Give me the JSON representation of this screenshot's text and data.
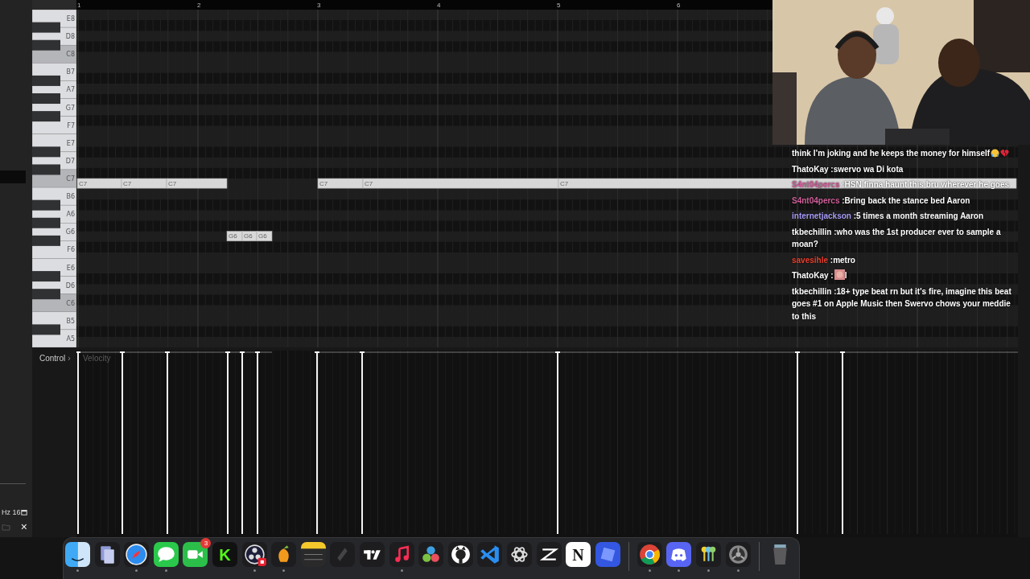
{
  "ruler": {
    "bars": [
      "1",
      "2",
      "3",
      "4",
      "5",
      "6"
    ]
  },
  "piano": {
    "keys": [
      {
        "label": "E8",
        "highlighted": false
      },
      {
        "label": "D8",
        "highlighted": false
      },
      {
        "label": "C8",
        "highlighted": true
      },
      {
        "label": "B7",
        "highlighted": false
      },
      {
        "label": "A7",
        "highlighted": false
      },
      {
        "label": "G7",
        "highlighted": false
      },
      {
        "label": "F7",
        "highlighted": false
      },
      {
        "label": "E7",
        "highlighted": false
      },
      {
        "label": "D7",
        "highlighted": false
      },
      {
        "label": "C7",
        "highlighted": true
      },
      {
        "label": "B6",
        "highlighted": false
      },
      {
        "label": "A6",
        "highlighted": false
      },
      {
        "label": "G6",
        "highlighted": false
      },
      {
        "label": "F6",
        "highlighted": false
      },
      {
        "label": "E6",
        "highlighted": false
      },
      {
        "label": "D6",
        "highlighted": false
      },
      {
        "label": "C6",
        "highlighted": true
      },
      {
        "label": "B5",
        "highlighted": false
      },
      {
        "label": "A5",
        "highlighted": false
      }
    ]
  },
  "notes": [
    {
      "label": "C7"
    },
    {
      "label": "C7"
    },
    {
      "label": "C7"
    },
    {
      "label": "G6"
    },
    {
      "label": "G6"
    },
    {
      "label": "G6"
    },
    {
      "label": "C7"
    },
    {
      "label": "C7"
    },
    {
      "label": "C7"
    }
  ],
  "control": {
    "label": "Control",
    "arrow": "›",
    "parameter": "Velocity"
  },
  "sidebar": {
    "readout": "Hz 16",
    "close": "×"
  },
  "chat": [
    {
      "text": "think I’m joking and he keeps the money for himself",
      "emoji": [
        {
          "kind": "crying-face"
        },
        {
          "kind": "broken-heart"
        }
      ]
    },
    {
      "user": "ThatoKay",
      "sep": ":",
      "color": "#ffffff",
      "text": "swervo wa Di kota"
    },
    {
      "user": "S4nt04percs",
      "sep": ":",
      "color": "#d0609a",
      "text": "HSN finna haunt this bru wherever he goes"
    },
    {
      "user": "S4nt04percs",
      "sep": ":",
      "color": "#d0609a",
      "text": "Bring back the stance bed Aaron"
    },
    {
      "user": "internetjackson",
      "sep": ":",
      "color": "#a79cf5",
      "text": "5 times a month streaming Aaron"
    },
    {
      "user": "tkbechillin",
      "sep": ":",
      "color": "#ffffff",
      "text": "who was the 1st producer ever to sample a moan?"
    },
    {
      "user": "savesihle",
      "sep": ":",
      "color": "#e8412f",
      "text": "metro"
    },
    {
      "user": "ThatoKay",
      "sep": ":",
      "color": "#ffffff",
      "emote": true,
      "text": "I"
    },
    {
      "user": "tkbechillin",
      "sep": ":",
      "color": "#ffffff",
      "text": "18+ type beat rn but it's fire, imagine this beat goes #1 on Apple Music then Swervo chows your meddie to this"
    }
  ],
  "dock": [
    {
      "kind": "finder",
      "running": true
    },
    {
      "kind": "files",
      "running": false
    },
    {
      "kind": "safari",
      "running": true
    },
    {
      "kind": "messages",
      "running": true
    },
    {
      "kind": "facetime",
      "running": false,
      "badge": "3"
    },
    {
      "kind": "kick",
      "running": false,
      "glyph": "K"
    },
    {
      "kind": "obs",
      "running": true
    },
    {
      "kind": "fruit",
      "running": true
    },
    {
      "kind": "notes",
      "running": false
    },
    {
      "kind": "slash",
      "running": false
    },
    {
      "kind": "tradingview",
      "running": false
    },
    {
      "kind": "music",
      "running": true
    },
    {
      "kind": "resolve",
      "running": false
    },
    {
      "kind": "github",
      "running": false
    },
    {
      "kind": "vscode",
      "running": false
    },
    {
      "kind": "openai",
      "running": false
    },
    {
      "kind": "capcut",
      "running": false
    },
    {
      "kind": "notion",
      "running": false,
      "glyph": "N"
    },
    {
      "kind": "roblox",
      "running": false
    },
    {
      "kind": "separator"
    },
    {
      "kind": "chrome",
      "running": true
    },
    {
      "kind": "discord",
      "running": true
    },
    {
      "kind": "keys",
      "running": true
    },
    {
      "kind": "settings",
      "running": true
    },
    {
      "kind": "separator"
    },
    {
      "kind": "trash",
      "running": false
    }
  ]
}
